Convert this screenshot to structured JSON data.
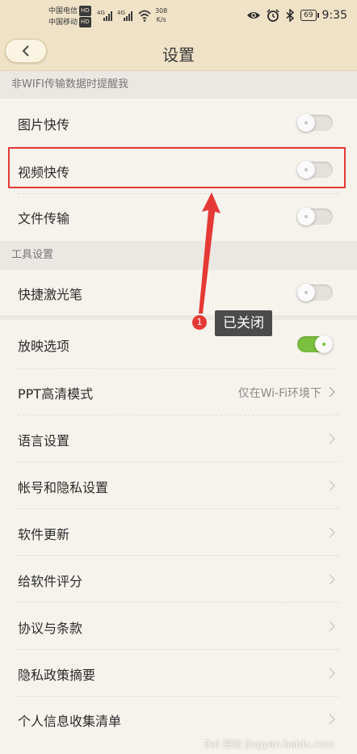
{
  "status_bar": {
    "carrier_1": "中国电信",
    "carrier_2": "中国移动",
    "hd_badge": "HD",
    "net_speed_value": "308",
    "net_speed_unit": "K/s",
    "battery": "69",
    "time": "9:35",
    "icons": [
      "eye-icon",
      "alarm-icon",
      "bluetooth-icon",
      "battery-icon",
      "wifi-icon",
      "signal-icon"
    ]
  },
  "header": {
    "title": "设置",
    "back_icon": "chevron-left-icon"
  },
  "sections": {
    "wifi_reminder": "非WIFI传输数据时提醒我",
    "tools": "工具设置"
  },
  "rows": {
    "photo_transfer": {
      "label": "图片快传",
      "toggle_on": false
    },
    "video_transfer": {
      "label": "视频快传",
      "toggle_on": false
    },
    "file_transfer": {
      "label": "文件传输",
      "toggle_on": false
    },
    "laser_pointer": {
      "label": "快捷激光笔",
      "toggle_on": false
    },
    "slideshow_options": {
      "label": "放映选项",
      "toggle_on": true
    },
    "ppt_hd_mode": {
      "label": "PPT高清模式",
      "value": "仅在Wi-Fi环境下"
    },
    "language": {
      "label": "语言设置"
    },
    "account_privacy": {
      "label": "帐号和隐私设置"
    },
    "software_update": {
      "label": "软件更新"
    },
    "rate_app": {
      "label": "给软件评分"
    },
    "terms": {
      "label": "协议与条款"
    },
    "privacy_summary": {
      "label": "隐私政策摘要"
    },
    "personal_info": {
      "label": "个人信息收集清单"
    }
  },
  "annotation": {
    "badge_number": "1",
    "text": "已关闭",
    "color": "#e53935"
  },
  "watermark": "Bai 经验 jingyan.baidu.com",
  "colors": {
    "header_bg": "#efe2c7",
    "body_bg": "#f6f3ed",
    "toggle_on": "#7bbf3e"
  }
}
